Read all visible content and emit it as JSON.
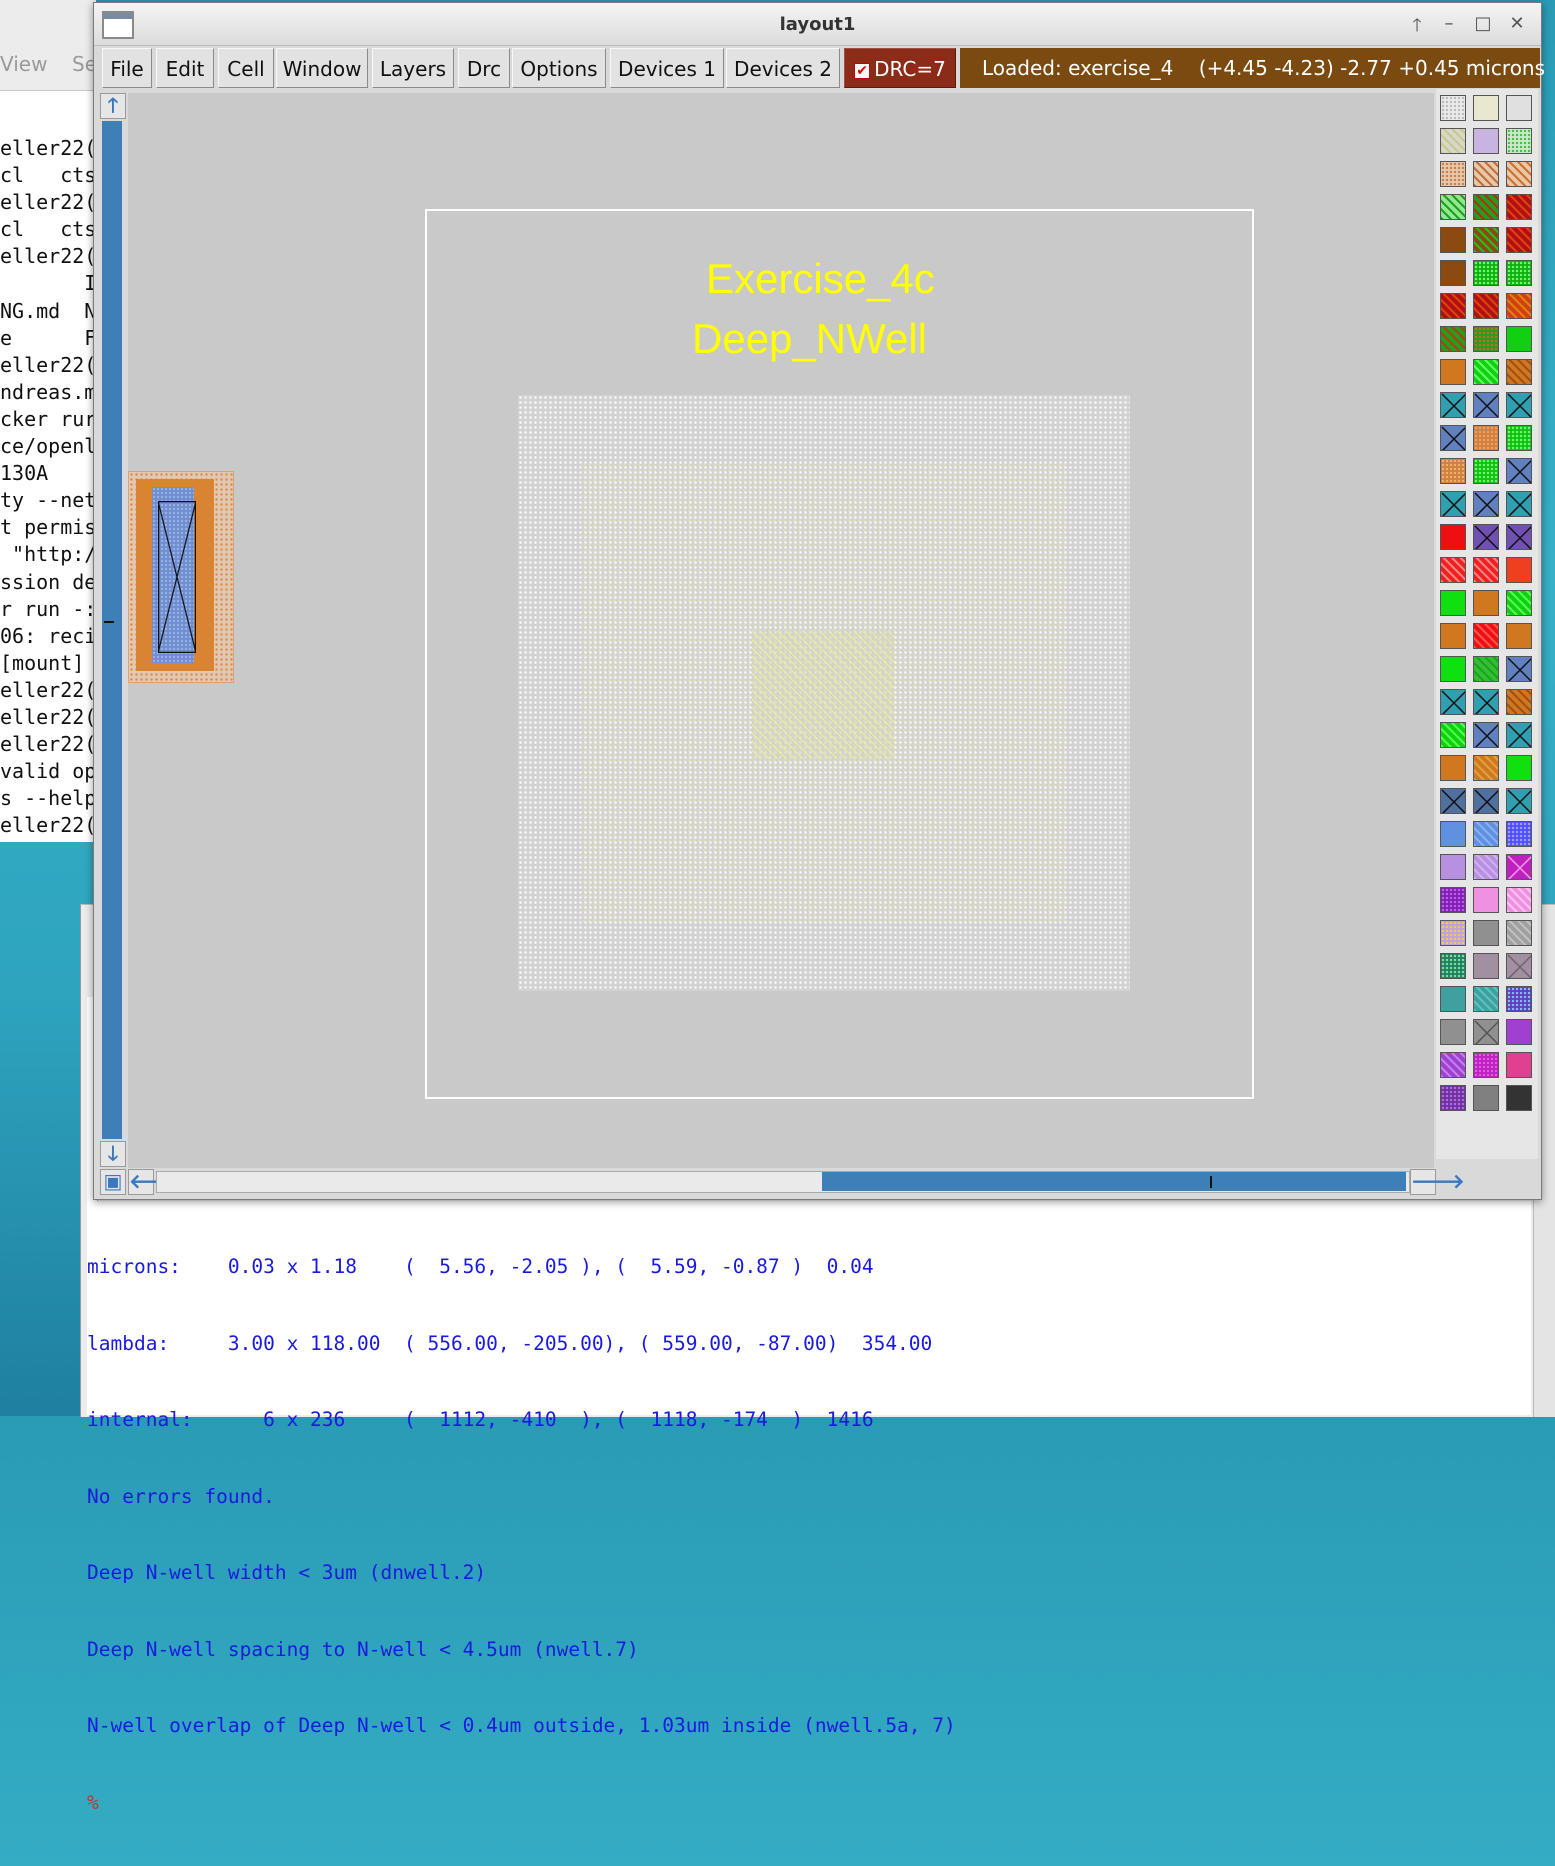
{
  "background_terminal": {
    "menu": [
      "View",
      "Se"
    ],
    "lines": [
      "eller22(",
      "cl   cts",
      "eller22(",
      "cl   cts",
      "eller22(",
      "       I",
      "NG.md  N",
      "e      F",
      "eller22(",
      "ndreas.m",
      "cker rur",
      "ce/openl",
      "130A    ",
      "ty --net",
      "t permis",
      " \"http:/",
      "ssion de",
      "r run -:",
      "06: reci",
      "[mount] ",
      "eller22(",
      "eller22(",
      "eller22(",
      "valid op",
      "s --help",
      "eller22("
    ]
  },
  "window": {
    "title": "layout1",
    "controls": {
      "up": "🡑",
      "minimize": "–",
      "maximize": "□",
      "close": "✕"
    }
  },
  "menubar": {
    "items": [
      "File",
      "Edit",
      "Cell",
      "Window",
      "Layers",
      "Drc",
      "Options",
      "Devices 1",
      "Devices 2"
    ],
    "drc": "DRC=7",
    "status": "Loaded: exercise_4    (+4.45 -4.23) -2.77 +0.45 microns"
  },
  "canvas": {
    "label_1": "Exercise_4c",
    "label_2": "Deep_NWell"
  },
  "palette_icons": [
    "layer-swatch"
  ],
  "console": {
    "lines": [
      "microns:    0.03 x 1.18    (  5.56, -2.05 ), (  5.59, -0.87 )  0.04",
      "lambda:     3.00 x 118.00  ( 556.00, -205.00), ( 559.00, -87.00)  354.00",
      "internal:      6 x 236     (  1112, -410  ), (  1118, -174  )  1416",
      "No errors found.",
      "Deep N-well width < 3um (dnwell.2)",
      "Deep N-well spacing to N-well < 4.5um (nwell.7)",
      "N-well overlap of Deep N-well < 0.4um outside, 1.03um inside (nwell.5a, 7)"
    ],
    "prompt": "%"
  },
  "colors": {
    "drc_bg": "#8a2c17",
    "status_bg": "#7a4a10",
    "canvas_bg": "#c9c9c9",
    "label_color": "#ffff00",
    "console_text": "#1a1adf",
    "scroll_blue": "#3f7fb8"
  }
}
